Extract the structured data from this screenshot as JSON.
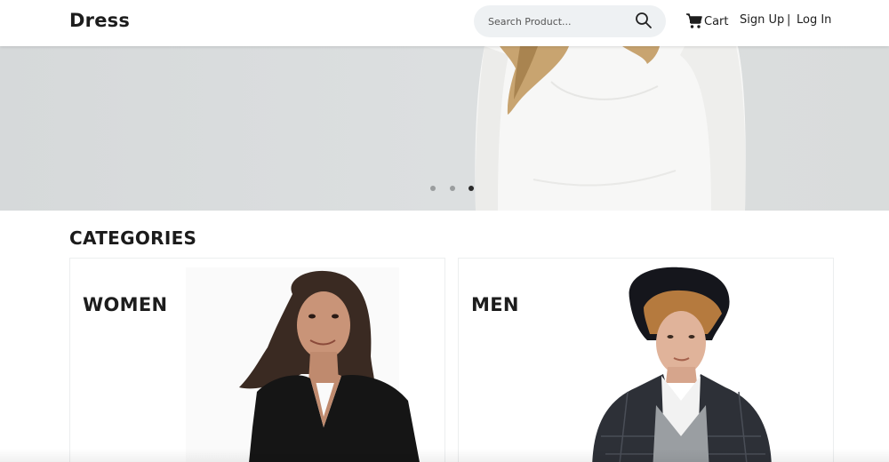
{
  "header": {
    "logo": "Dress",
    "search_placeholder": "Search Product...",
    "search_icon": "search-icon",
    "cart_label": "Cart",
    "cart_icon": "cart-icon",
    "signup_label": "Sign Up",
    "separator": "|",
    "login_label": "Log In"
  },
  "hero": {
    "slide_count": 3,
    "active_slide": 3
  },
  "categories": {
    "title": "CATEGORIES",
    "items": [
      {
        "label": "WOMEN"
      },
      {
        "label": "MEN"
      }
    ]
  },
  "colors": {
    "text": "#1b1b1b",
    "search_bg": "#eef1f3",
    "hero_bg": "#d9dcdc",
    "dot_active": "#2a2a2a",
    "dot_inactive": "#9a9d9e"
  }
}
